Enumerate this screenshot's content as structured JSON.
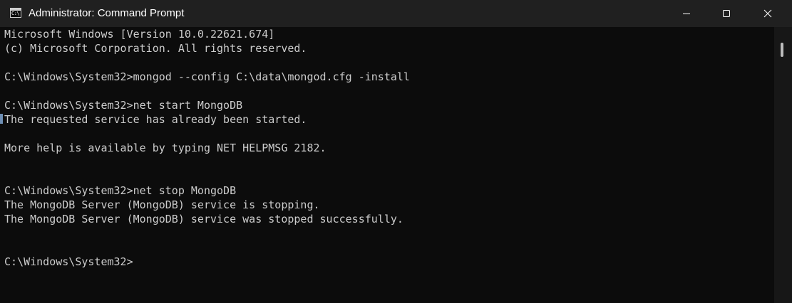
{
  "window": {
    "title": "Administrator: Command Prompt",
    "icon": "command-prompt-icon",
    "icon_glyph": "C:\\",
    "controls": [
      "minimize-icon",
      "maximize-icon",
      "close-icon"
    ]
  },
  "console": {
    "lines": [
      "Microsoft Windows [Version 10.0.22621.674]",
      "(c) Microsoft Corporation. All rights reserved.",
      "",
      "C:\\Windows\\System32>mongod --config C:\\data\\mongod.cfg -install",
      "",
      "C:\\Windows\\System32>net start MongoDB",
      "The requested service has already been started.",
      "",
      "More help is available by typing NET HELPMSG 2182.",
      "",
      "",
      "C:\\Windows\\System32>net stop MongoDB",
      "The MongoDB Server (MongoDB) service is stopping.",
      "The MongoDB Server (MongoDB) service was stopped successfully.",
      "",
      "",
      "C:\\Windows\\System32>"
    ]
  },
  "colors": {
    "titlebar_bg": "#202020",
    "console_bg": "#0c0c0c",
    "console_text": "#cccccc",
    "title_text": "#ffffff"
  }
}
